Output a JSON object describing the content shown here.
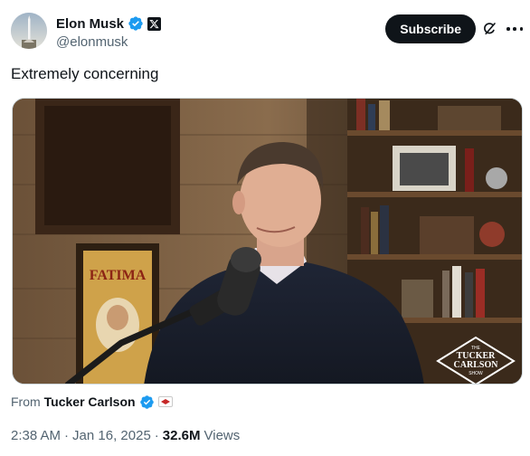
{
  "author": {
    "display_name": "Elon Musk",
    "handle": "@elonmusk",
    "verified_icon": "verified-badge-icon",
    "affiliate_icon": "x-logo-icon"
  },
  "actions": {
    "subscribe_label": "Subscribe",
    "grok_icon": "grok-icon",
    "more_icon": "more-dots-icon"
  },
  "tweet": {
    "text": "Extremely concerning"
  },
  "media": {
    "logo_line1": "THE",
    "logo_line2": "TUCKER",
    "logo_line3": "CARLSON",
    "logo_line4": "SHOW",
    "poster_text": "FATIMA"
  },
  "source": {
    "prefix": "From",
    "name": "Tucker Carlson",
    "verified_icon": "verified-badge-icon",
    "affiliate_icon": "tucker-carlson-network-icon"
  },
  "meta": {
    "time": "2:38 AM",
    "date": "Jan 16, 2025",
    "views_count": "32.6M",
    "views_label": "Views",
    "separator": "·"
  },
  "colors": {
    "primary_text": "#0f1419",
    "secondary_text": "#536471",
    "verified_blue": "#1d9bf0",
    "subscribe_bg": "#0f1419"
  }
}
